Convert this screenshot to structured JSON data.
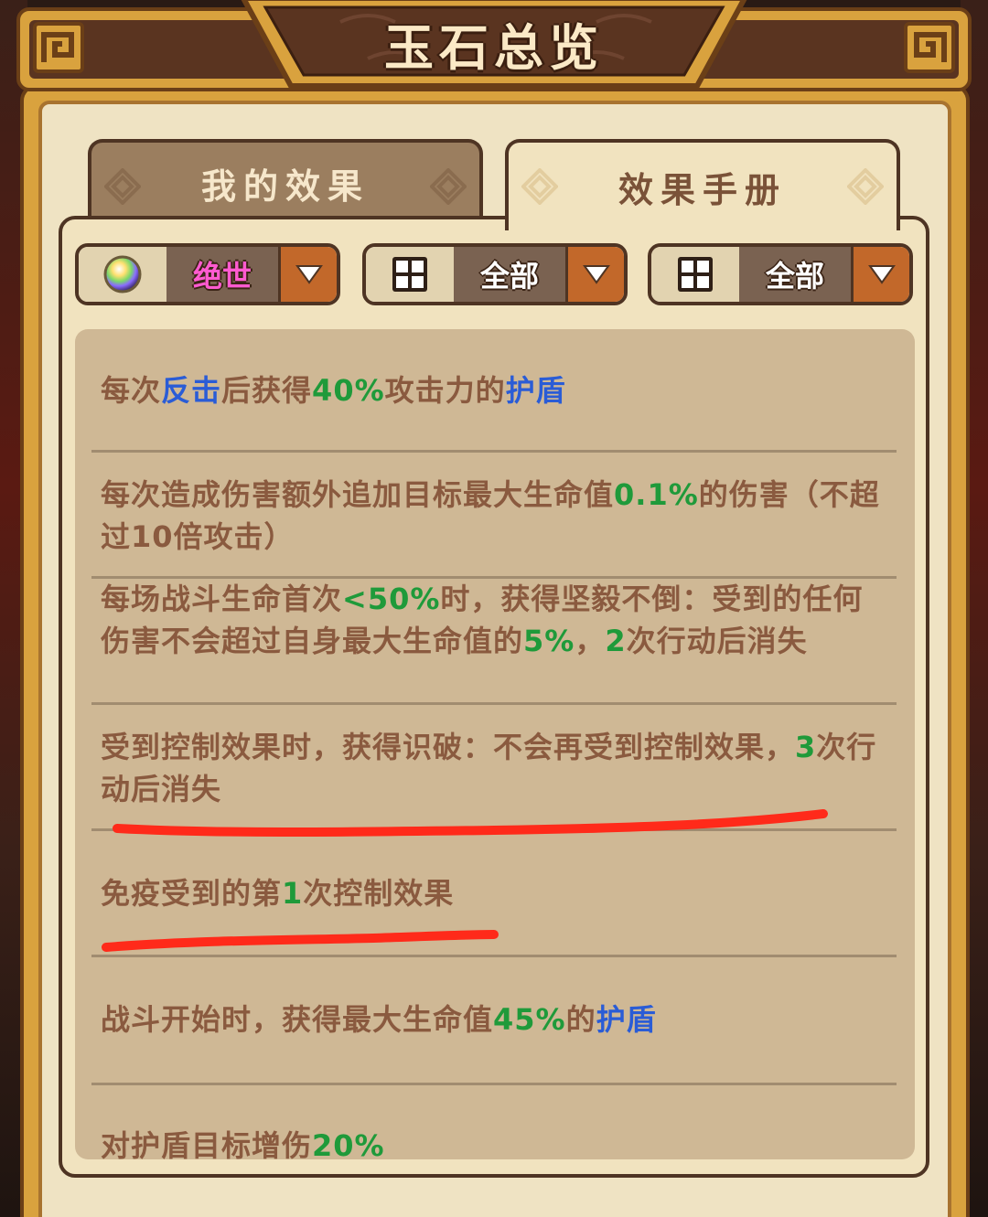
{
  "window": {
    "title": "玉石总览"
  },
  "tabs": [
    {
      "label": "我的效果",
      "active": false
    },
    {
      "label": "效果手册",
      "active": true
    }
  ],
  "filters": [
    {
      "icon": "gem-orb-icon",
      "value": "绝世",
      "value_color": "#ff5bd0"
    },
    {
      "icon": "grid-icon",
      "value": "全部",
      "value_color": "#ffffff"
    },
    {
      "icon": "grid-icon",
      "value": "全部",
      "value_color": "#ffffff"
    }
  ],
  "effects": [
    {
      "segments": [
        {
          "text": "每次"
        },
        {
          "text": "反击",
          "style": "blue"
        },
        {
          "text": "后获得"
        },
        {
          "text": "40%",
          "style": "green"
        },
        {
          "text": "攻击力的"
        },
        {
          "text": "护盾",
          "style": "blue"
        }
      ]
    },
    {
      "segments": [
        {
          "text": "每次造成伤害额外追加目标最大生命值"
        },
        {
          "text": "0.1%",
          "style": "green"
        },
        {
          "text": "的伤害（不超过10倍攻击）"
        }
      ]
    },
    {
      "segments": [
        {
          "text": "每场战斗生命首次"
        },
        {
          "text": "<50%",
          "style": "green"
        },
        {
          "text": "时，获得坚毅不倒：受到的任何伤害不会超过自身最大生命值的"
        },
        {
          "text": "5%",
          "style": "green"
        },
        {
          "text": "，"
        },
        {
          "text": "2",
          "style": "green"
        },
        {
          "text": "次行动后消失"
        }
      ]
    },
    {
      "segments": [
        {
          "text": "受到控制效果时，获得识破：不会再受到控制效果，"
        },
        {
          "text": "3",
          "style": "green"
        },
        {
          "text": "次行动后消失"
        }
      ]
    },
    {
      "segments": [
        {
          "text": "免疫受到的第"
        },
        {
          "text": "1",
          "style": "green"
        },
        {
          "text": "次控制效果"
        }
      ]
    },
    {
      "segments": [
        {
          "text": "战斗开始时，获得最大生命值"
        },
        {
          "text": "45%",
          "style": "green"
        },
        {
          "text": "的"
        },
        {
          "text": "护盾",
          "style": "blue"
        }
      ]
    },
    {
      "segments": [
        {
          "text": "对护盾目标增伤"
        },
        {
          "text": "20%",
          "style": "green"
        }
      ]
    }
  ],
  "colors": {
    "frame_gold": "#d9a23e",
    "panel_cream": "#f1e3bf",
    "list_tan": "#cfb895",
    "text_brown": "#8a5a3f",
    "value_green": "#1f9a3a",
    "keyword_blue": "#2a5cd6",
    "annotation_red": "#ff2a1a"
  }
}
